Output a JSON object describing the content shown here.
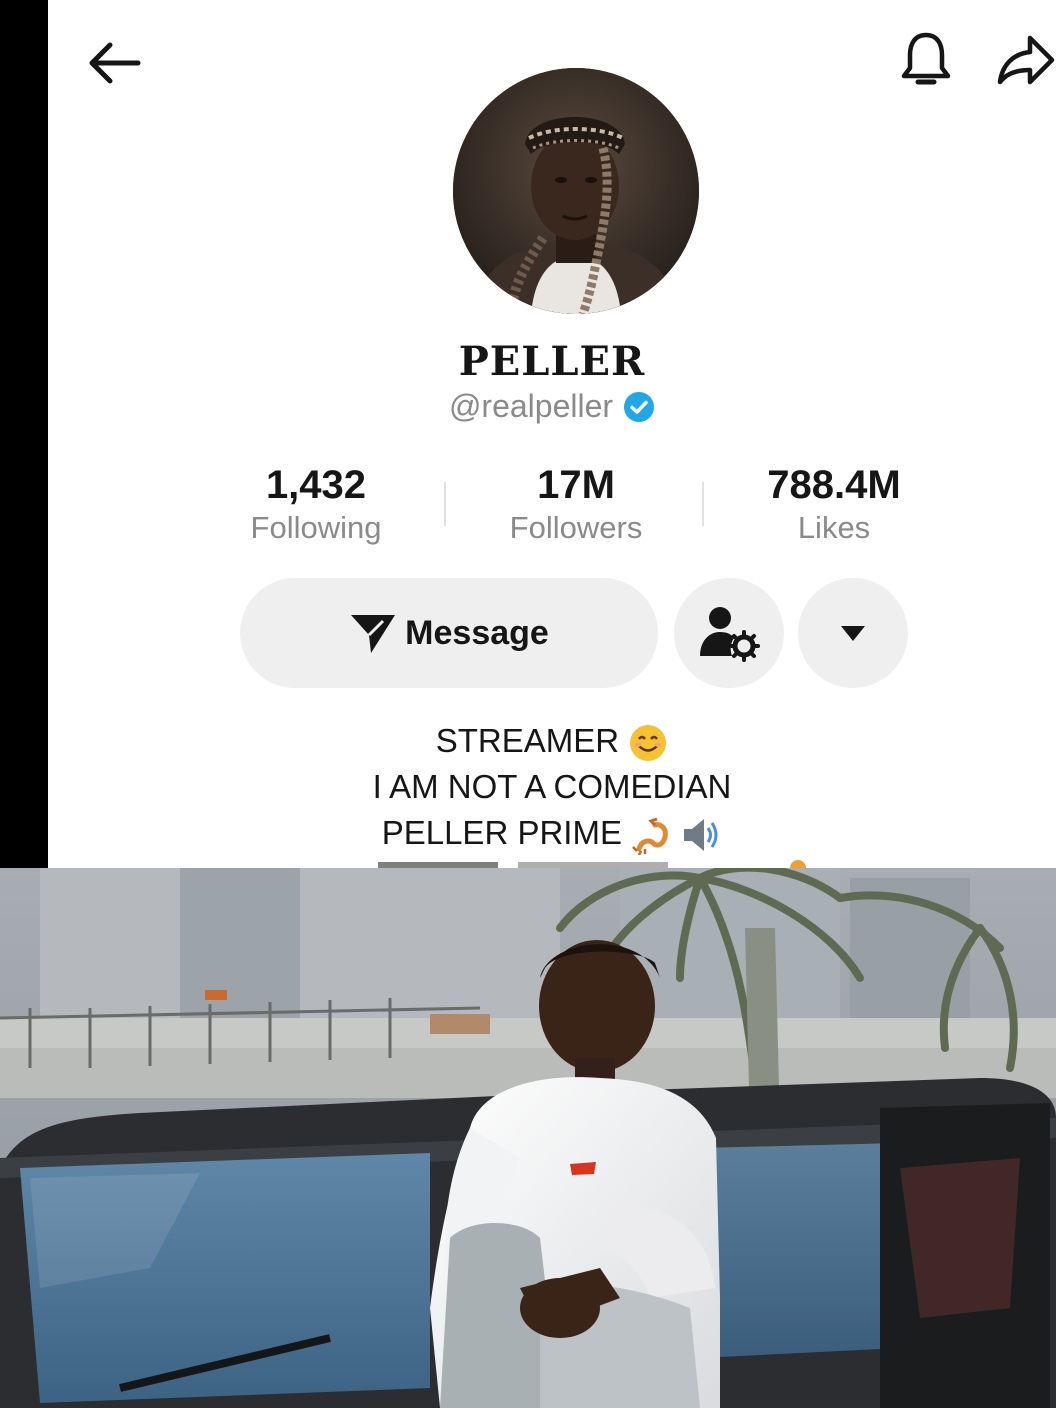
{
  "header": {
    "back_icon": "arrow-left-icon",
    "bell_icon": "bell-icon",
    "share_icon": "share-arrow-icon"
  },
  "profile": {
    "display_name": "PELLER",
    "handle": "@realpeller",
    "verified": true,
    "verified_color": "#20a7e8"
  },
  "stats": [
    {
      "value": "1,432",
      "label": "Following"
    },
    {
      "value": "17M",
      "label": "Followers"
    },
    {
      "value": "788.4M",
      "label": "Likes"
    }
  ],
  "actions": {
    "message_label": "Message",
    "message_icon": "send-arrow-icon",
    "friend_icon": "user-settings-icon",
    "more_icon": "caret-down-icon"
  },
  "bio": {
    "line1": "STREAMER",
    "line1_emoji": "smiling-face-emoji",
    "line2": "I AM NOT A COMEDIAN",
    "line3": "PELLER PRIME",
    "line3_emoji": "scorpion-and-speaker-emoji"
  },
  "colors": {
    "background": "#ffffff",
    "text_primary": "#161616",
    "text_secondary": "#8a8a8a",
    "button_bg": "#efefef"
  }
}
